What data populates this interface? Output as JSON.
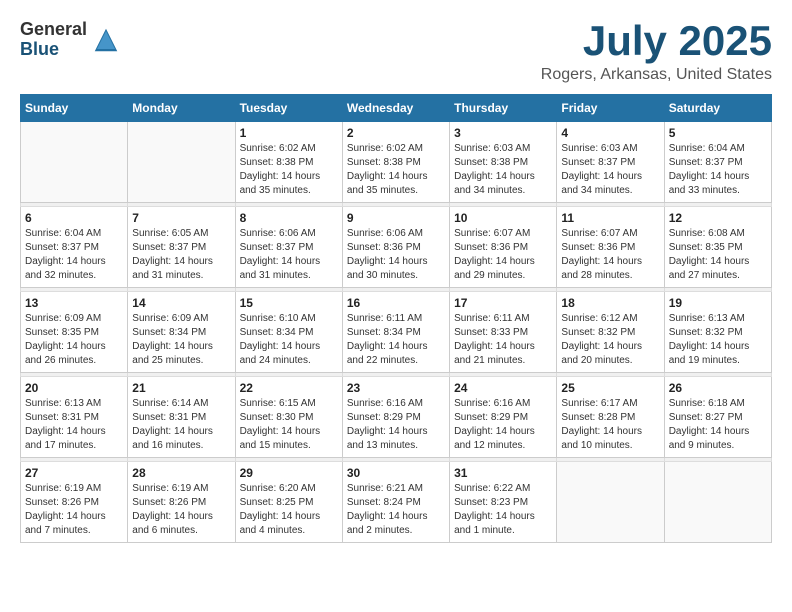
{
  "logo": {
    "general": "General",
    "blue": "Blue"
  },
  "title": "July 2025",
  "location": "Rogers, Arkansas, United States",
  "days_of_week": [
    "Sunday",
    "Monday",
    "Tuesday",
    "Wednesday",
    "Thursday",
    "Friday",
    "Saturday"
  ],
  "weeks": [
    [
      {
        "day": "",
        "info": ""
      },
      {
        "day": "",
        "info": ""
      },
      {
        "day": "1",
        "info": "Sunrise: 6:02 AM\nSunset: 8:38 PM\nDaylight: 14 hours and 35 minutes."
      },
      {
        "day": "2",
        "info": "Sunrise: 6:02 AM\nSunset: 8:38 PM\nDaylight: 14 hours and 35 minutes."
      },
      {
        "day": "3",
        "info": "Sunrise: 6:03 AM\nSunset: 8:38 PM\nDaylight: 14 hours and 34 minutes."
      },
      {
        "day": "4",
        "info": "Sunrise: 6:03 AM\nSunset: 8:37 PM\nDaylight: 14 hours and 34 minutes."
      },
      {
        "day": "5",
        "info": "Sunrise: 6:04 AM\nSunset: 8:37 PM\nDaylight: 14 hours and 33 minutes."
      }
    ],
    [
      {
        "day": "6",
        "info": "Sunrise: 6:04 AM\nSunset: 8:37 PM\nDaylight: 14 hours and 32 minutes."
      },
      {
        "day": "7",
        "info": "Sunrise: 6:05 AM\nSunset: 8:37 PM\nDaylight: 14 hours and 31 minutes."
      },
      {
        "day": "8",
        "info": "Sunrise: 6:06 AM\nSunset: 8:37 PM\nDaylight: 14 hours and 31 minutes."
      },
      {
        "day": "9",
        "info": "Sunrise: 6:06 AM\nSunset: 8:36 PM\nDaylight: 14 hours and 30 minutes."
      },
      {
        "day": "10",
        "info": "Sunrise: 6:07 AM\nSunset: 8:36 PM\nDaylight: 14 hours and 29 minutes."
      },
      {
        "day": "11",
        "info": "Sunrise: 6:07 AM\nSunset: 8:36 PM\nDaylight: 14 hours and 28 minutes."
      },
      {
        "day": "12",
        "info": "Sunrise: 6:08 AM\nSunset: 8:35 PM\nDaylight: 14 hours and 27 minutes."
      }
    ],
    [
      {
        "day": "13",
        "info": "Sunrise: 6:09 AM\nSunset: 8:35 PM\nDaylight: 14 hours and 26 minutes."
      },
      {
        "day": "14",
        "info": "Sunrise: 6:09 AM\nSunset: 8:34 PM\nDaylight: 14 hours and 25 minutes."
      },
      {
        "day": "15",
        "info": "Sunrise: 6:10 AM\nSunset: 8:34 PM\nDaylight: 14 hours and 24 minutes."
      },
      {
        "day": "16",
        "info": "Sunrise: 6:11 AM\nSunset: 8:34 PM\nDaylight: 14 hours and 22 minutes."
      },
      {
        "day": "17",
        "info": "Sunrise: 6:11 AM\nSunset: 8:33 PM\nDaylight: 14 hours and 21 minutes."
      },
      {
        "day": "18",
        "info": "Sunrise: 6:12 AM\nSunset: 8:32 PM\nDaylight: 14 hours and 20 minutes."
      },
      {
        "day": "19",
        "info": "Sunrise: 6:13 AM\nSunset: 8:32 PM\nDaylight: 14 hours and 19 minutes."
      }
    ],
    [
      {
        "day": "20",
        "info": "Sunrise: 6:13 AM\nSunset: 8:31 PM\nDaylight: 14 hours and 17 minutes."
      },
      {
        "day": "21",
        "info": "Sunrise: 6:14 AM\nSunset: 8:31 PM\nDaylight: 14 hours and 16 minutes."
      },
      {
        "day": "22",
        "info": "Sunrise: 6:15 AM\nSunset: 8:30 PM\nDaylight: 14 hours and 15 minutes."
      },
      {
        "day": "23",
        "info": "Sunrise: 6:16 AM\nSunset: 8:29 PM\nDaylight: 14 hours and 13 minutes."
      },
      {
        "day": "24",
        "info": "Sunrise: 6:16 AM\nSunset: 8:29 PM\nDaylight: 14 hours and 12 minutes."
      },
      {
        "day": "25",
        "info": "Sunrise: 6:17 AM\nSunset: 8:28 PM\nDaylight: 14 hours and 10 minutes."
      },
      {
        "day": "26",
        "info": "Sunrise: 6:18 AM\nSunset: 8:27 PM\nDaylight: 14 hours and 9 minutes."
      }
    ],
    [
      {
        "day": "27",
        "info": "Sunrise: 6:19 AM\nSunset: 8:26 PM\nDaylight: 14 hours and 7 minutes."
      },
      {
        "day": "28",
        "info": "Sunrise: 6:19 AM\nSunset: 8:26 PM\nDaylight: 14 hours and 6 minutes."
      },
      {
        "day": "29",
        "info": "Sunrise: 6:20 AM\nSunset: 8:25 PM\nDaylight: 14 hours and 4 minutes."
      },
      {
        "day": "30",
        "info": "Sunrise: 6:21 AM\nSunset: 8:24 PM\nDaylight: 14 hours and 2 minutes."
      },
      {
        "day": "31",
        "info": "Sunrise: 6:22 AM\nSunset: 8:23 PM\nDaylight: 14 hours and 1 minute."
      },
      {
        "day": "",
        "info": ""
      },
      {
        "day": "",
        "info": ""
      }
    ]
  ]
}
